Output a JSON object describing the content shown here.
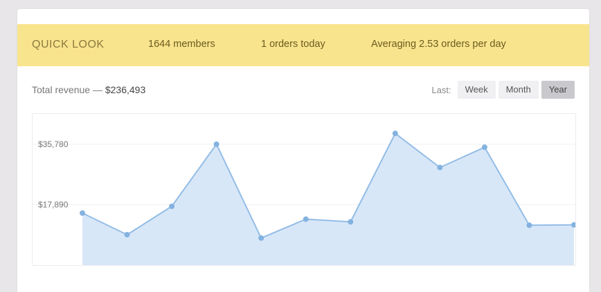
{
  "quick_look": {
    "title": "QUICK LOOK",
    "members": "1644 members",
    "orders_today": "1 orders today",
    "average": "Averaging 2.53 orders per day"
  },
  "revenue": {
    "label": "Total revenue —",
    "amount": "$236,493"
  },
  "range": {
    "label": "Last:",
    "options": [
      "Week",
      "Month",
      "Year"
    ],
    "selected": "Year"
  },
  "colors": {
    "banner": "#f9e48e",
    "line": "#92bce6",
    "fill": "#d6e6f8",
    "point": "#84b2e0"
  },
  "chart_data": {
    "type": "area",
    "ytick_labels": [
      "$17,890",
      "$35,780"
    ],
    "yticks": [
      17890,
      35780
    ],
    "ylim": [
      0,
      40000
    ],
    "grid": true,
    "legend": "none",
    "x": [
      1,
      2,
      3,
      4,
      5,
      6,
      7,
      8,
      9,
      10,
      11,
      12
    ],
    "series": [
      {
        "values": [
          15400,
          9000,
          17400,
          35800,
          8000,
          13600,
          12800,
          39000,
          28900,
          34900,
          11800,
          11900
        ]
      }
    ]
  }
}
